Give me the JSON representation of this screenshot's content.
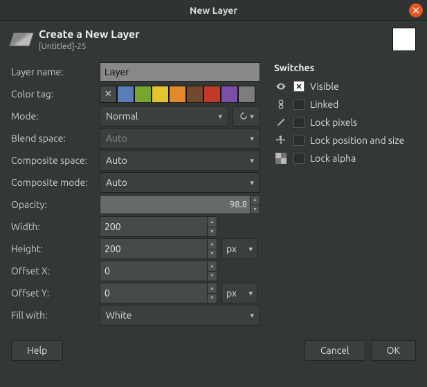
{
  "window": {
    "title": "New Layer"
  },
  "header": {
    "title": "Create a New Layer",
    "subtitle": "[Untitled]-25"
  },
  "labels": {
    "layer_name": "Layer name:",
    "color_tag": "Color tag:",
    "mode": "Mode:",
    "blend_space": "Blend space:",
    "composite_space": "Composite space:",
    "composite_mode": "Composite mode:",
    "opacity": "Opacity:",
    "width": "Width:",
    "height": "Height:",
    "offset_x": "Offset X:",
    "offset_y": "Offset Y:",
    "fill_with": "Fill with:"
  },
  "values": {
    "layer_name": "Layer",
    "mode": "Normal",
    "blend_space": "Auto",
    "composite_space": "Auto",
    "composite_mode": "Auto",
    "opacity": "98.8",
    "width": "200",
    "height": "200",
    "offset_x": "0",
    "offset_y": "0",
    "fill_with": "White",
    "unit_wh": "px",
    "unit_xy": "px"
  },
  "color_tags": [
    "none",
    "#5a7fb8",
    "#77a62e",
    "#e4c430",
    "#e08a2c",
    "#6f4a2d",
    "#c0392b",
    "#7b4fa8",
    "#7d7d7d"
  ],
  "opacity_percent": 98.8,
  "switches": {
    "title": "Switches",
    "items": [
      {
        "icon": "eye",
        "label": "Visible",
        "checked": true
      },
      {
        "icon": "link",
        "label": "Linked",
        "checked": false
      },
      {
        "icon": "brush",
        "label": "Lock pixels",
        "checked": false
      },
      {
        "icon": "move",
        "label": "Lock position and size",
        "checked": false
      },
      {
        "icon": "checker",
        "label": "Lock alpha",
        "checked": false
      }
    ]
  },
  "buttons": {
    "help": "Help",
    "cancel": "Cancel",
    "ok": "OK"
  }
}
